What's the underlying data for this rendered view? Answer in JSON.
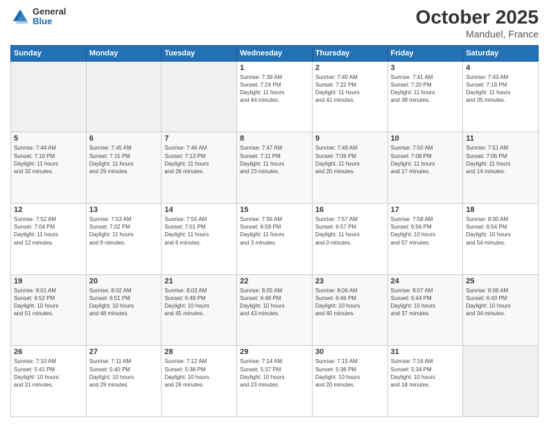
{
  "header": {
    "logo": {
      "general": "General",
      "blue": "Blue"
    },
    "title": "October 2025",
    "location": "Manduel, France"
  },
  "calendar": {
    "days_of_week": [
      "Sunday",
      "Monday",
      "Tuesday",
      "Wednesday",
      "Thursday",
      "Friday",
      "Saturday"
    ],
    "weeks": [
      [
        {
          "day": "",
          "info": ""
        },
        {
          "day": "",
          "info": ""
        },
        {
          "day": "",
          "info": ""
        },
        {
          "day": "1",
          "info": "Sunrise: 7:39 AM\nSunset: 7:24 PM\nDaylight: 11 hours\nand 44 minutes."
        },
        {
          "day": "2",
          "info": "Sunrise: 7:40 AM\nSunset: 7:22 PM\nDaylight: 11 hours\nand 41 minutes."
        },
        {
          "day": "3",
          "info": "Sunrise: 7:41 AM\nSunset: 7:20 PM\nDaylight: 11 hours\nand 38 minutes."
        },
        {
          "day": "4",
          "info": "Sunrise: 7:43 AM\nSunset: 7:18 PM\nDaylight: 11 hours\nand 35 minutes."
        }
      ],
      [
        {
          "day": "5",
          "info": "Sunrise: 7:44 AM\nSunset: 7:16 PM\nDaylight: 11 hours\nand 32 minutes."
        },
        {
          "day": "6",
          "info": "Sunrise: 7:45 AM\nSunset: 7:15 PM\nDaylight: 11 hours\nand 29 minutes."
        },
        {
          "day": "7",
          "info": "Sunrise: 7:46 AM\nSunset: 7:13 PM\nDaylight: 11 hours\nand 26 minutes."
        },
        {
          "day": "8",
          "info": "Sunrise: 7:47 AM\nSunset: 7:11 PM\nDaylight: 11 hours\nand 23 minutes."
        },
        {
          "day": "9",
          "info": "Sunrise: 7:49 AM\nSunset: 7:09 PM\nDaylight: 11 hours\nand 20 minutes."
        },
        {
          "day": "10",
          "info": "Sunrise: 7:50 AM\nSunset: 7:08 PM\nDaylight: 11 hours\nand 17 minutes."
        },
        {
          "day": "11",
          "info": "Sunrise: 7:51 AM\nSunset: 7:06 PM\nDaylight: 11 hours\nand 14 minutes."
        }
      ],
      [
        {
          "day": "12",
          "info": "Sunrise: 7:52 AM\nSunset: 7:04 PM\nDaylight: 11 hours\nand 12 minutes."
        },
        {
          "day": "13",
          "info": "Sunrise: 7:53 AM\nSunset: 7:02 PM\nDaylight: 11 hours\nand 9 minutes."
        },
        {
          "day": "14",
          "info": "Sunrise: 7:55 AM\nSunset: 7:01 PM\nDaylight: 11 hours\nand 6 minutes."
        },
        {
          "day": "15",
          "info": "Sunrise: 7:56 AM\nSunset: 6:59 PM\nDaylight: 11 hours\nand 3 minutes."
        },
        {
          "day": "16",
          "info": "Sunrise: 7:57 AM\nSunset: 6:57 PM\nDaylight: 11 hours\nand 0 minutes."
        },
        {
          "day": "17",
          "info": "Sunrise: 7:58 AM\nSunset: 6:56 PM\nDaylight: 10 hours\nand 57 minutes."
        },
        {
          "day": "18",
          "info": "Sunrise: 8:00 AM\nSunset: 6:54 PM\nDaylight: 10 hours\nand 54 minutes."
        }
      ],
      [
        {
          "day": "19",
          "info": "Sunrise: 8:01 AM\nSunset: 6:52 PM\nDaylight: 10 hours\nand 51 minutes."
        },
        {
          "day": "20",
          "info": "Sunrise: 8:02 AM\nSunset: 6:51 PM\nDaylight: 10 hours\nand 48 minutes."
        },
        {
          "day": "21",
          "info": "Sunrise: 8:03 AM\nSunset: 6:49 PM\nDaylight: 10 hours\nand 45 minutes."
        },
        {
          "day": "22",
          "info": "Sunrise: 8:05 AM\nSunset: 6:48 PM\nDaylight: 10 hours\nand 43 minutes."
        },
        {
          "day": "23",
          "info": "Sunrise: 8:06 AM\nSunset: 6:46 PM\nDaylight: 10 hours\nand 40 minutes."
        },
        {
          "day": "24",
          "info": "Sunrise: 8:07 AM\nSunset: 6:44 PM\nDaylight: 10 hours\nand 37 minutes."
        },
        {
          "day": "25",
          "info": "Sunrise: 8:08 AM\nSunset: 6:43 PM\nDaylight: 10 hours\nand 34 minutes."
        }
      ],
      [
        {
          "day": "26",
          "info": "Sunrise: 7:10 AM\nSunset: 5:41 PM\nDaylight: 10 hours\nand 31 minutes."
        },
        {
          "day": "27",
          "info": "Sunrise: 7:11 AM\nSunset: 5:40 PM\nDaylight: 10 hours\nand 29 minutes."
        },
        {
          "day": "28",
          "info": "Sunrise: 7:12 AM\nSunset: 5:38 PM\nDaylight: 10 hours\nand 26 minutes."
        },
        {
          "day": "29",
          "info": "Sunrise: 7:14 AM\nSunset: 5:37 PM\nDaylight: 10 hours\nand 23 minutes."
        },
        {
          "day": "30",
          "info": "Sunrise: 7:15 AM\nSunset: 5:36 PM\nDaylight: 10 hours\nand 20 minutes."
        },
        {
          "day": "31",
          "info": "Sunrise: 7:16 AM\nSunset: 5:34 PM\nDaylight: 10 hours\nand 18 minutes."
        },
        {
          "day": "",
          "info": ""
        }
      ]
    ]
  }
}
